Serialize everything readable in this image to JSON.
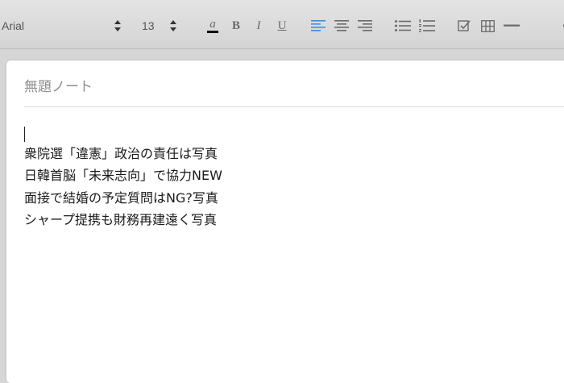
{
  "toolbar": {
    "font_family": "Arial",
    "font_size": "13",
    "icons": [
      "text-color-icon",
      "bold-icon",
      "italic-icon",
      "underline-icon",
      "align-left-icon",
      "align-center-icon",
      "align-right-icon",
      "bullet-list-icon",
      "numbered-list-icon",
      "checkbox-icon",
      "table-icon",
      "horizontal-rule-icon"
    ],
    "text_color_glyph": "a",
    "bold_glyph": "B",
    "italic_glyph": "I",
    "underline_glyph": "U",
    "active_color": "#3a8ee6"
  },
  "note": {
    "title": "無題ノート",
    "lines": [
      "衆院選「違憲」政治の責任は写真",
      "日韓首脳「未来志向」で協力NEW",
      "面接で結婚の予定質問はNG?写真",
      "シャープ提携も財務再建遠く写真"
    ]
  }
}
